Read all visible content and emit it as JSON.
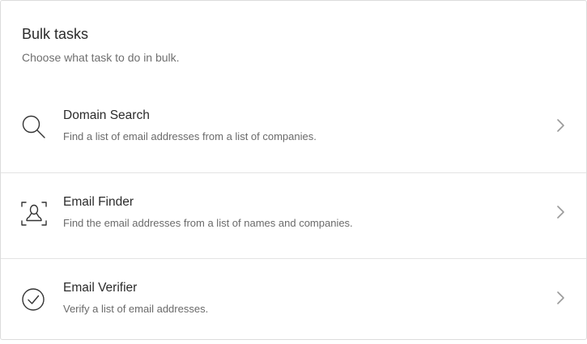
{
  "header": {
    "title": "Bulk tasks",
    "subtitle": "Choose what task to do in bulk."
  },
  "tasks": [
    {
      "title": "Domain Search",
      "description": "Find a list of email addresses from a list of companies.",
      "icon": "search-icon"
    },
    {
      "title": "Email Finder",
      "description": "Find the email addresses from a list of names and companies.",
      "icon": "person-scan-icon"
    },
    {
      "title": "Email Verifier",
      "description": "Verify a list of email addresses.",
      "icon": "check-circle-icon"
    }
  ],
  "colors": {
    "border": "#dcdcdc",
    "title_text": "#2b2b2b",
    "muted_text": "#6f6f6f",
    "icon_stroke": "#333333",
    "chevron": "#9a9a9a"
  }
}
